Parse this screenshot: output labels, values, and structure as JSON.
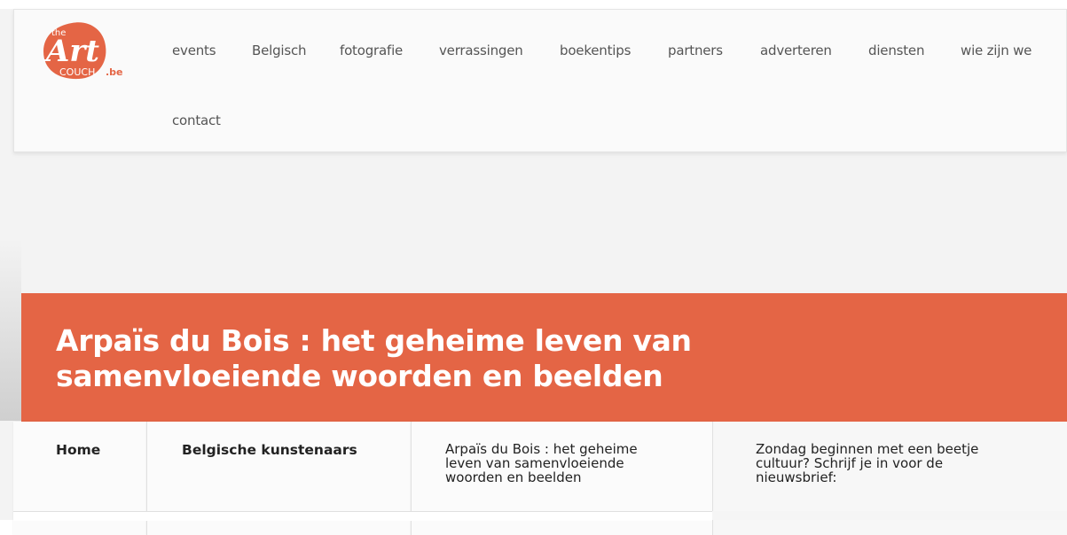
{
  "site": {
    "logo_alt": "the Art COUCH.be",
    "brand_color": "#e46545"
  },
  "nav": {
    "items": [
      {
        "label": "events"
      },
      {
        "label": "Belgisch"
      },
      {
        "label": "fotografie"
      },
      {
        "label": "verrassingen"
      },
      {
        "label": "boekentips"
      },
      {
        "label": "partners"
      },
      {
        "label": "adverteren"
      },
      {
        "label": "diensten"
      },
      {
        "label": "wie zijn we"
      },
      {
        "label": "contact"
      }
    ]
  },
  "article": {
    "title_line1": "Arpaïs du Bois : het geheime leven van",
    "title_line2": "samenvloeiende woorden en beelden"
  },
  "breadcrumb": {
    "home": "Home",
    "category": "Belgische kunstenaars",
    "current_line1": "Arpaïs du Bois : het geheime",
    "current_line2": "leven van samenvloeiende",
    "current_line3": "woorden en beelden"
  },
  "sidebar": {
    "newsletter_line1": "Zondag beginnen met een beetje",
    "newsletter_line2": "cultuur? Schrijf je in voor de",
    "newsletter_line3": "nieuwsbrief:"
  }
}
